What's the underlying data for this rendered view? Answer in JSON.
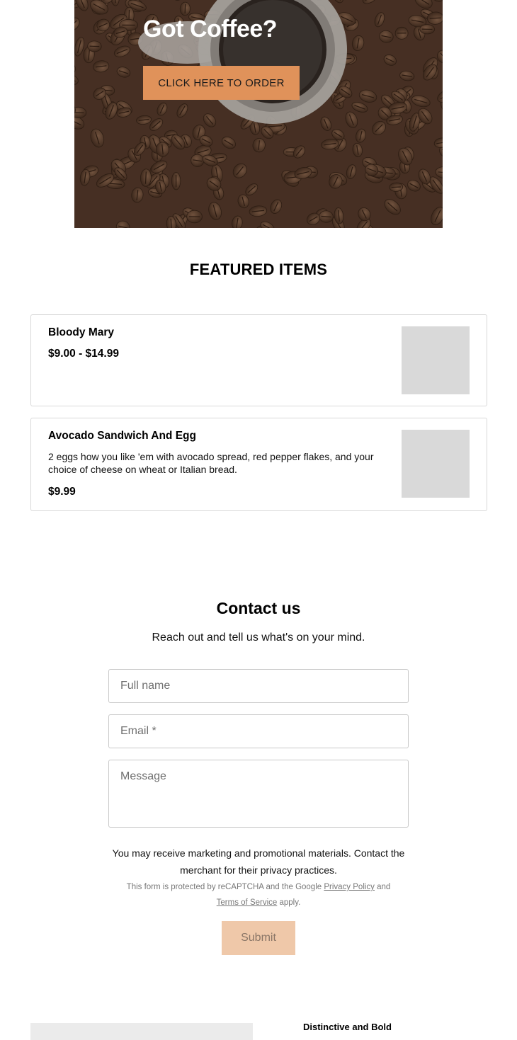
{
  "hero": {
    "title": "Got Coffee?",
    "cta_label": "CLICK HERE TO ORDER",
    "accent_color": "#e0925a"
  },
  "featured": {
    "title": "FEATURED ITEMS",
    "items": [
      {
        "name": "Bloody Mary",
        "price": "$9.00 - $14.99",
        "description": ""
      },
      {
        "name": "Avocado Sandwich And Egg",
        "price": "$9.99",
        "description": "2 eggs how you like 'em with avocado spread, red pepper flakes, and your choice of cheese on wheat or Italian bread."
      }
    ]
  },
  "contact": {
    "title": "Contact us",
    "subtitle": "Reach out and tell us what's on your mind.",
    "name_placeholder": "Full name",
    "email_placeholder": "Email *",
    "message_placeholder": "Message",
    "legal_text": "You may receive marketing and promotional materials. Contact the merchant for their privacy practices.",
    "recaptcha_prefix": "This form is protected by reCAPTCHA and the Google",
    "privacy_link": "Privacy Policy",
    "recaptcha_and": "and",
    "terms_link": "Terms of Service",
    "recaptcha_suffix": "apply.",
    "submit_label": "Submit"
  },
  "footer": {
    "heading": "Distinctive and Bold"
  }
}
